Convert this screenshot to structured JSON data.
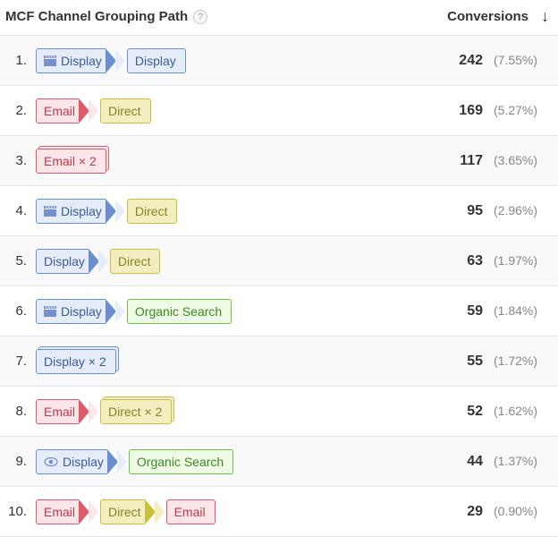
{
  "headers": {
    "path": "MCF Channel Grouping Path",
    "conversions": "Conversions"
  },
  "rows": [
    {
      "rank": "1.",
      "conversions": "242",
      "pct": "(7.55%)",
      "path": [
        {
          "label": "Display",
          "type": "display",
          "icon": "clapper",
          "arrow": true,
          "stack": false
        },
        {
          "label": "Display",
          "type": "display",
          "icon": "",
          "arrow": false,
          "stack": false
        }
      ]
    },
    {
      "rank": "2.",
      "conversions": "169",
      "pct": "(5.27%)",
      "path": [
        {
          "label": "Email",
          "type": "email",
          "icon": "",
          "arrow": true,
          "stack": false
        },
        {
          "label": "Direct",
          "type": "direct",
          "icon": "",
          "arrow": false,
          "stack": false
        }
      ]
    },
    {
      "rank": "3.",
      "conversions": "117",
      "pct": "(3.65%)",
      "path": [
        {
          "label": "Email × 2",
          "type": "email",
          "icon": "",
          "arrow": false,
          "stack": true
        }
      ]
    },
    {
      "rank": "4.",
      "conversions": "95",
      "pct": "(2.96%)",
      "path": [
        {
          "label": "Display",
          "type": "display",
          "icon": "clapper",
          "arrow": true,
          "stack": false
        },
        {
          "label": "Direct",
          "type": "direct",
          "icon": "",
          "arrow": false,
          "stack": false
        }
      ]
    },
    {
      "rank": "5.",
      "conversions": "63",
      "pct": "(1.97%)",
      "path": [
        {
          "label": "Display",
          "type": "display",
          "icon": "",
          "arrow": true,
          "stack": false
        },
        {
          "label": "Direct",
          "type": "direct",
          "icon": "",
          "arrow": false,
          "stack": false
        }
      ]
    },
    {
      "rank": "6.",
      "conversions": "59",
      "pct": "(1.84%)",
      "path": [
        {
          "label": "Display",
          "type": "display",
          "icon": "clapper",
          "arrow": true,
          "stack": false
        },
        {
          "label": "Organic Search",
          "type": "organic",
          "icon": "",
          "arrow": false,
          "stack": false
        }
      ]
    },
    {
      "rank": "7.",
      "conversions": "55",
      "pct": "(1.72%)",
      "path": [
        {
          "label": "Display × 2",
          "type": "display",
          "icon": "",
          "arrow": false,
          "stack": true
        }
      ]
    },
    {
      "rank": "8.",
      "conversions": "52",
      "pct": "(1.62%)",
      "path": [
        {
          "label": "Email",
          "type": "email",
          "icon": "",
          "arrow": true,
          "stack": false
        },
        {
          "label": "Direct × 2",
          "type": "direct",
          "icon": "",
          "arrow": false,
          "stack": true
        }
      ]
    },
    {
      "rank": "9.",
      "conversions": "44",
      "pct": "(1.37%)",
      "path": [
        {
          "label": "Display",
          "type": "display",
          "icon": "eye",
          "arrow": true,
          "stack": false
        },
        {
          "label": "Organic Search",
          "type": "organic",
          "icon": "",
          "arrow": false,
          "stack": false
        }
      ]
    },
    {
      "rank": "10.",
      "conversions": "29",
      "pct": "(0.90%)",
      "path": [
        {
          "label": "Email",
          "type": "email",
          "icon": "",
          "arrow": true,
          "stack": false
        },
        {
          "label": "Direct",
          "type": "direct",
          "icon": "",
          "arrow": true,
          "stack": false
        },
        {
          "label": "Email",
          "type": "email",
          "icon": "",
          "arrow": false,
          "stack": false
        }
      ]
    }
  ]
}
